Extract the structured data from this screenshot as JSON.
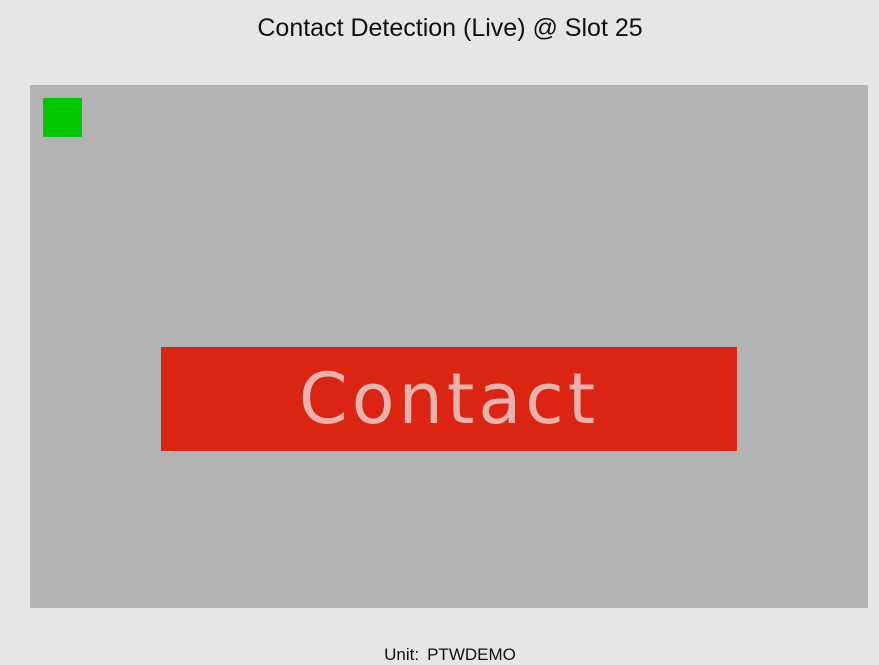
{
  "header": {
    "title": "Contact Detection (Live) @ Slot 25"
  },
  "display": {
    "status_indicator_color": "#00c800",
    "banner_label": "Contact",
    "banner_color": "#dc2412",
    "panel_color": "#b3b3b3"
  },
  "footer": {
    "unit_label": "Unit:",
    "unit_value": "PTWDEMO"
  }
}
